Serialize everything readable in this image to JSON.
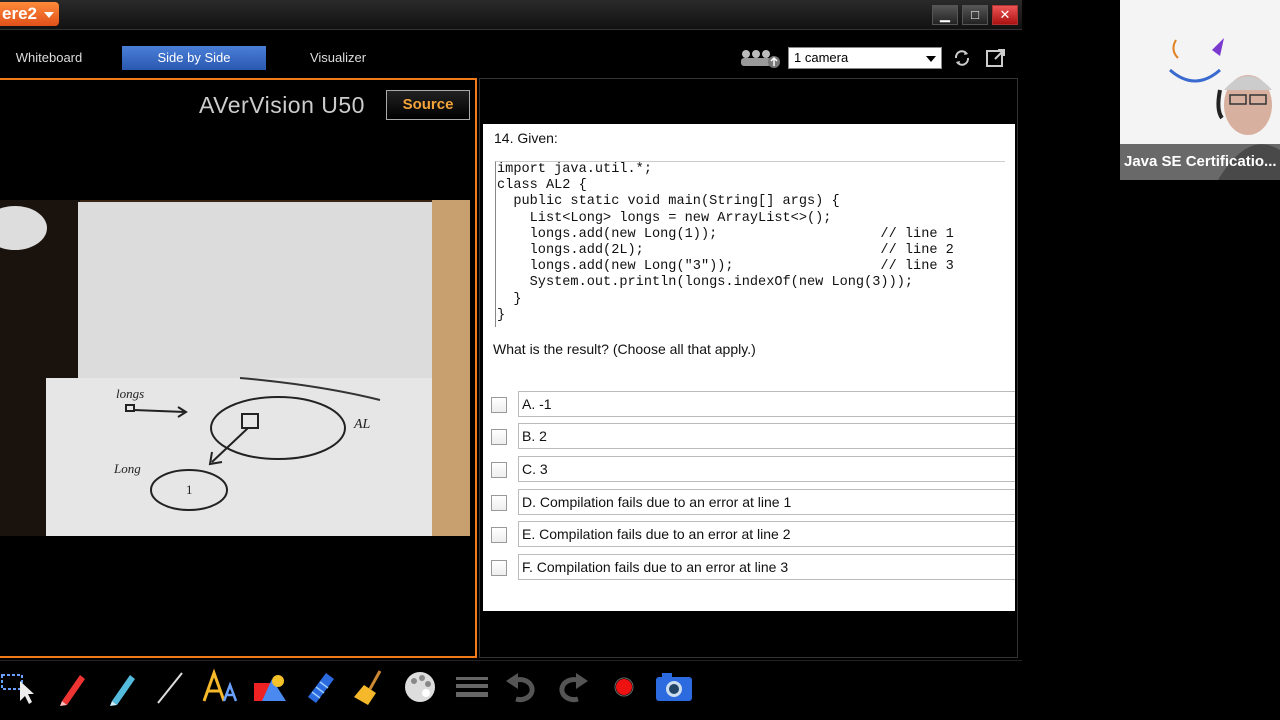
{
  "titlebar": {
    "app_name": "ere2",
    "minimize": "▁",
    "maximize": "□",
    "close": "✕"
  },
  "modes": [
    {
      "label": "Whiteboard",
      "active": false
    },
    {
      "label": "Side by Side",
      "active": true
    },
    {
      "label": "Visualizer",
      "active": false
    }
  ],
  "camera": {
    "selected": "1 camera"
  },
  "left_panel": {
    "title": "AVerVision U50",
    "source_button": "Source",
    "whiteboard_notes": {
      "label_longs": "longs",
      "label_al": "AL",
      "label_long": "Long",
      "label_one": "1"
    }
  },
  "question": {
    "title": "14. Given:",
    "code": "import java.util.*;\nclass AL2 {\n  public static void main(String[] args) {\n    List<Long> longs = new ArrayList<>();\n    longs.add(new Long(1));                    // line 1\n    longs.add(2L);                             // line 2\n    longs.add(new Long(\"3\"));                  // line 3\n    System.out.println(longs.indexOf(new Long(3)));\n  }\n}",
    "prompt": "What is the result? (Choose all that apply.)",
    "options": [
      "A. -1",
      "B. 2",
      "C. 3",
      "D. Compilation fails due to an error at line 1",
      "E. Compilation fails due to an error at line 2",
      "F. Compilation fails due to an error at line 3"
    ]
  },
  "webcam": {
    "label": "Java SE Certificatio..."
  },
  "colors": {
    "accent_orange": "#f07a1a",
    "active_tab_blue": "#2a58b0",
    "source_text": "#f3a43a"
  }
}
